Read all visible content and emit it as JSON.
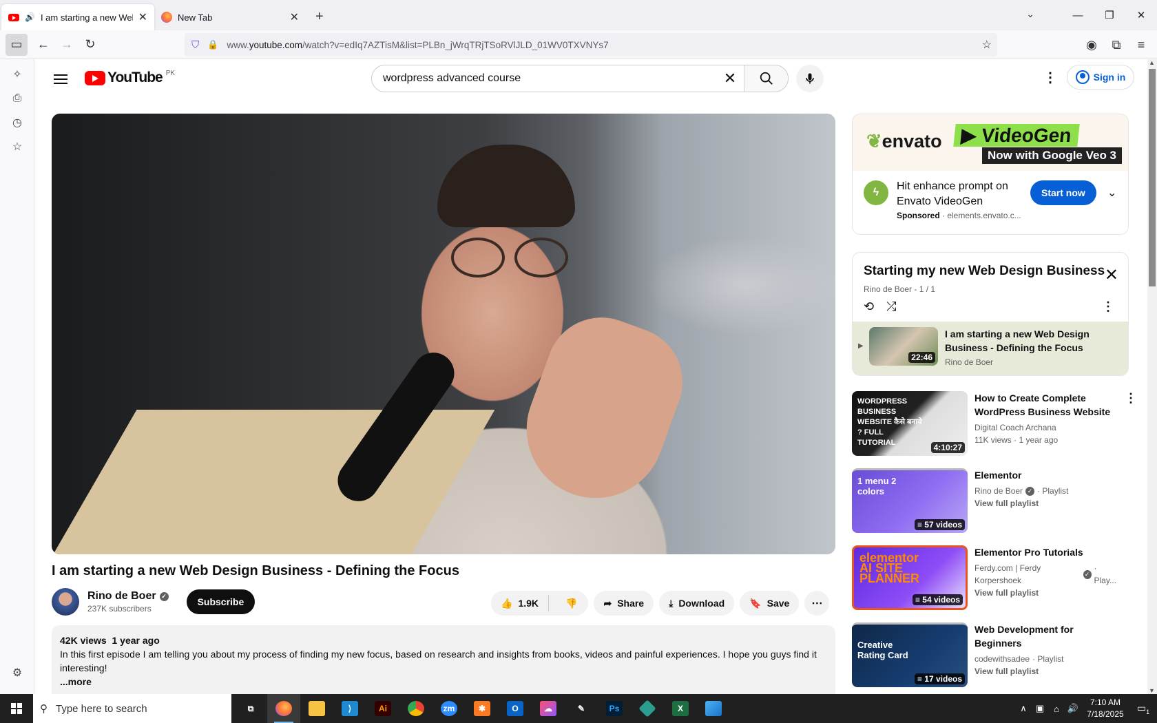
{
  "browser": {
    "tabs": [
      {
        "title": "I am starting a new Web De",
        "active": true
      },
      {
        "title": "New Tab",
        "active": false
      }
    ],
    "url_prefix": "www.",
    "url_domain": "youtube.com",
    "url_path": "/watch?v=edIq7AZTisM&list=PLBn_jWrqTRjTSoRVlJLD_01WV0TXVNYs7"
  },
  "youtube": {
    "logo_text": "YouTube",
    "country_code": "PK",
    "search_query": "wordpress advanced course",
    "signin_label": "Sign in",
    "video": {
      "title": "I am starting a new Web Design Business - Defining the Focus",
      "channel": "Rino de Boer",
      "subscribers": "237K subscribers",
      "subscribe_label": "Subscribe",
      "likes": "1.9K",
      "share_label": "Share",
      "download_label": "Download",
      "save_label": "Save",
      "views": "42K views",
      "age": "1 year ago",
      "description": "In this first episode I am telling you about my process of finding my new focus, based on research and insights from books, videos and painful experiences. I hope you guys find it interesting!",
      "more_label": "...more"
    },
    "ad": {
      "brand": "envato",
      "product": "VideoGen",
      "tagline": "Now with Google Veo 3",
      "text": "Hit enhance prompt on Envato VideoGen",
      "sponsored": "Sponsored",
      "domain": "elements.envato.c...",
      "cta": "Start now"
    },
    "playlist": {
      "title": "Starting my new Web Design Business",
      "sub": "Rino de Boer - 1 / 1",
      "current_title": "I am starting a new Web Design Business - Defining the Focus",
      "current_channel": "Rino de Boer",
      "current_duration": "22:46"
    },
    "recommendations": [
      {
        "title": "How to Create Complete WordPress Business Website ...",
        "channel": "Digital Coach Archana",
        "meta": "11K views · 1 year ago",
        "badge": "4:10:27",
        "thumb_text": "WORDPRESS BUSINESS WEBSITE कैसे बनाये ? FULL TUTORIAL"
      },
      {
        "title": "Elementor",
        "channel": "Rino de Boer",
        "kind": "· Playlist",
        "link": "View full playlist",
        "badge": "57 videos",
        "thumb_text": "1 menu 2 colors"
      },
      {
        "title": "Elementor Pro Tutorials",
        "channel": "Ferdy.com | Ferdy Korpershoek",
        "kind": "· Play...",
        "link": "View full playlist",
        "badge": "54 videos",
        "thumb_text": "elementor AI SITE PLANNER"
      },
      {
        "title": "Web Development for Beginners",
        "channel": "codewithsadee",
        "kind": "· Playlist",
        "link": "View full playlist",
        "badge": "17 videos",
        "thumb_text": "Creative Rating Card"
      }
    ]
  },
  "taskbar": {
    "search_placeholder": "Type here to search",
    "time": "7:10 AM",
    "date": "7/18/2025",
    "notif_count": "1"
  },
  "colors": {
    "youtube_red": "#ff0000",
    "link_blue": "#065fd4",
    "envato_green": "#82b541"
  }
}
